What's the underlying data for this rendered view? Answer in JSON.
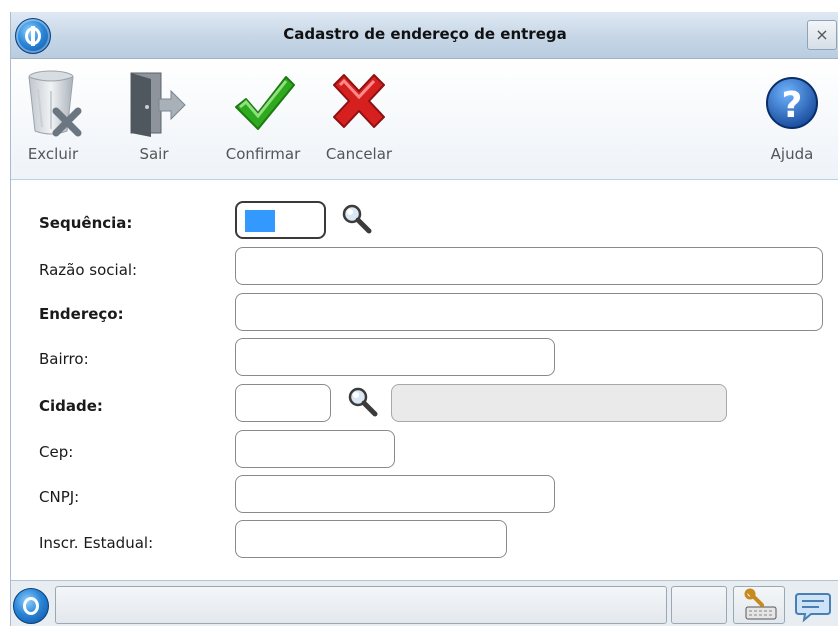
{
  "window": {
    "title": "Cadastro de endereço de entrega",
    "close_label": "×"
  },
  "toolbar": {
    "buttons": [
      {
        "label": "Excluir",
        "icon": "trash-icon"
      },
      {
        "label": "Sair",
        "icon": "exit-door-icon"
      },
      {
        "label": "Confirmar",
        "icon": "checkmark-icon"
      },
      {
        "label": "Cancelar",
        "icon": "cancel-x-icon"
      },
      {
        "label": "Ajuda",
        "icon": "help-icon"
      }
    ]
  },
  "form": {
    "fields": [
      {
        "label": "Sequência:",
        "value": "",
        "bold": true
      },
      {
        "label": "Razão social:",
        "value": "",
        "bold": false
      },
      {
        "label": "Endereço:",
        "value": "",
        "bold": true
      },
      {
        "label": "Bairro:",
        "value": "",
        "bold": false
      },
      {
        "label": "Cidade:",
        "value": "",
        "bold": true,
        "description": ""
      },
      {
        "label": "Cep:",
        "value": "",
        "bold": false
      },
      {
        "label": "CNPJ:",
        "value": "",
        "bold": false
      },
      {
        "label": "Inscr. Estadual:",
        "value": "",
        "bold": false
      }
    ]
  },
  "colors": {
    "accent": "#3399ff",
    "title_bar": "#c6d6e6",
    "confirm": "#2eaa1f",
    "cancel": "#d61f1f",
    "help": "#1a5fb8"
  }
}
